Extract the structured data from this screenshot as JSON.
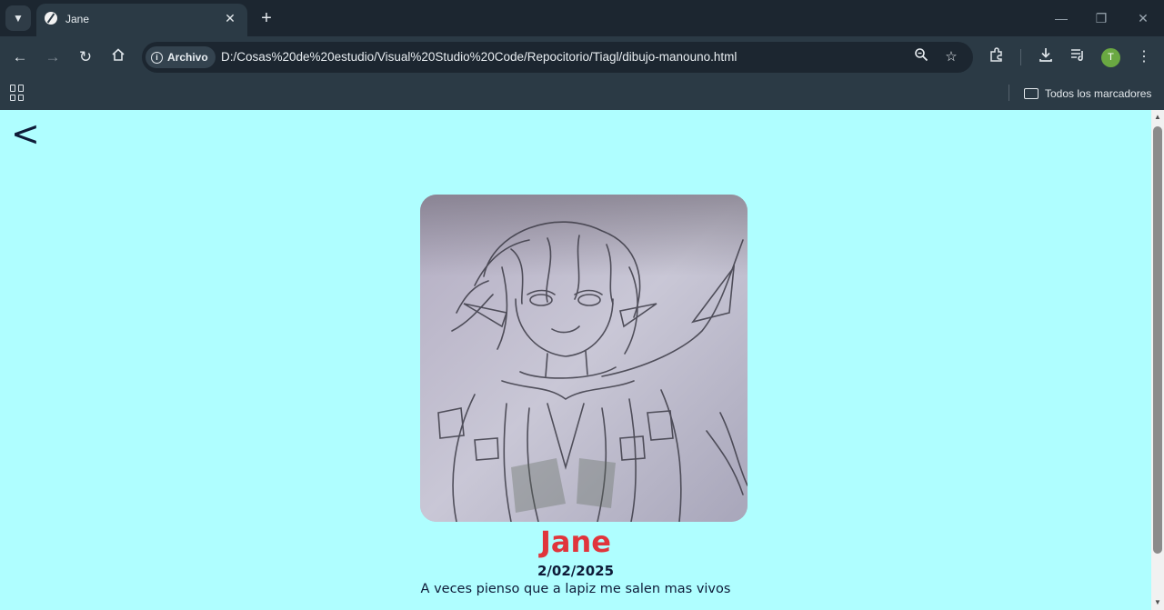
{
  "browser": {
    "tab_title": "Jane",
    "address_chip": "Archivo",
    "url": "D:/Cosas%20de%20estudio/Visual%20Studio%20Code/Repocitorio/Tiagl/dibujo-manouno.html",
    "profile_initial": "T",
    "bookmarks_all": "Todos los marcadores"
  },
  "page": {
    "back_label": "<",
    "title": "Jane",
    "date": "2/02/2025",
    "description": "A veces pienso que a lapiz me salen mas vivos"
  },
  "colors": {
    "page_background": "#affeff",
    "title": "#e0353c",
    "text": "#0e1b38"
  }
}
